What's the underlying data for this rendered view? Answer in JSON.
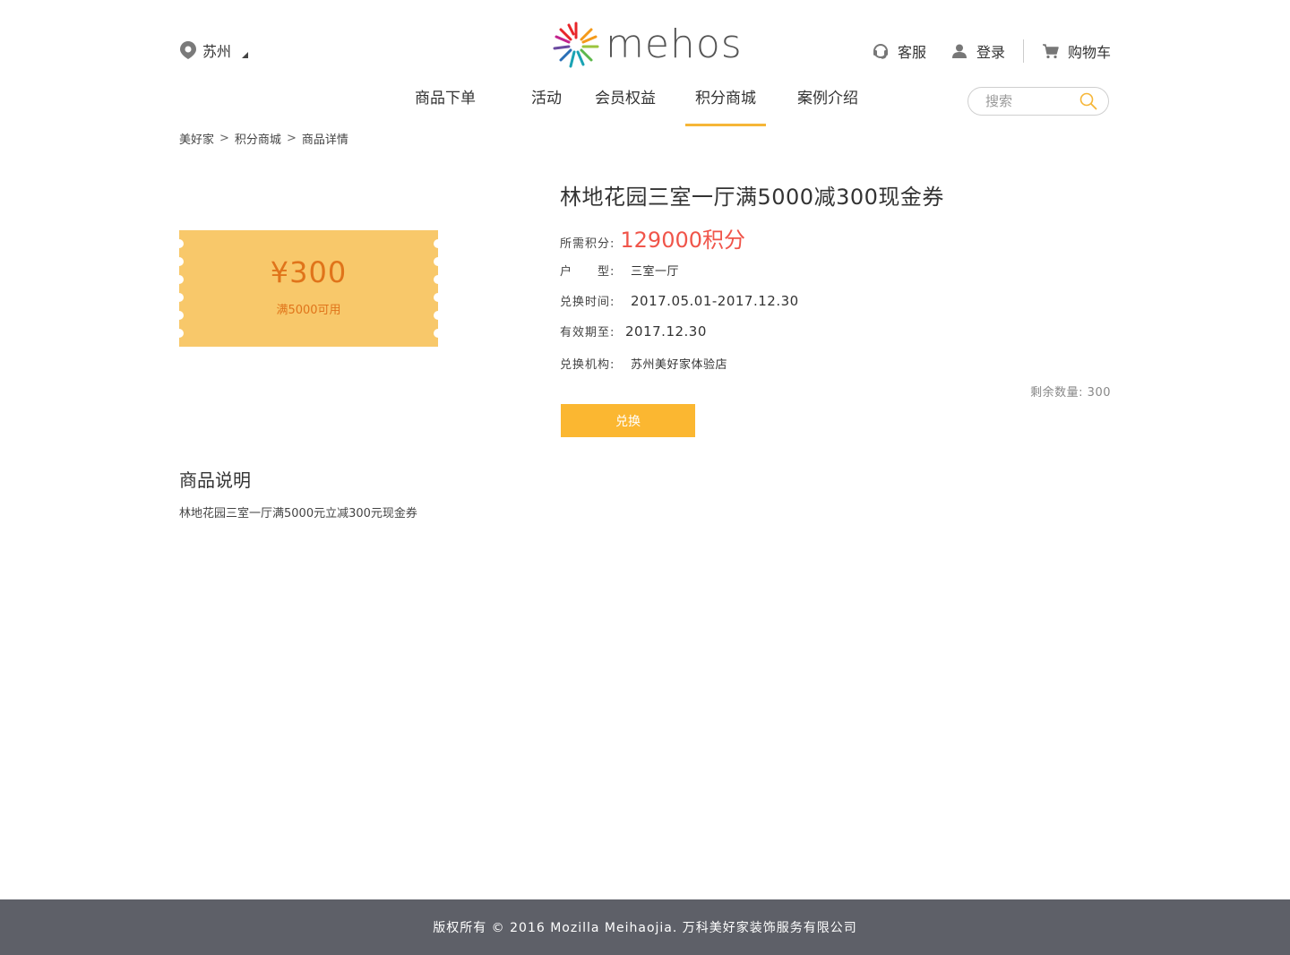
{
  "header": {
    "city": "苏州",
    "logo_text": "mehos",
    "service": "客服",
    "login": "登录",
    "cart": "购物车"
  },
  "nav": {
    "items": [
      "商品下单",
      "活动",
      "会员权益",
      "积分商城",
      "案例介绍"
    ],
    "active": "积分商城"
  },
  "search": {
    "placeholder": "搜索"
  },
  "breadcrumb": [
    "美好家",
    "积分商城",
    "商品详情"
  ],
  "coupon": {
    "amount": "¥300",
    "condition": "满5000可用"
  },
  "product": {
    "title": "林地花园三室一厅满5000减300现金券",
    "points_label": "所需积分:",
    "points_value": "129000积分",
    "type_label": "户　　型:",
    "type_value": "三室一厅",
    "time_label": "兑换时间:",
    "time_value": "2017.05.01-2017.12.30",
    "valid_label": "有效期至:",
    "valid_value": "2017.12.30",
    "org_label": "兑换机构:",
    "org_value": "苏州美好家体验店",
    "remain": "剩余数量: 300",
    "exchange_button": "兑换"
  },
  "description": {
    "heading": "商品说明",
    "text": "林地花园三室一厅满5000元立减300元现金券"
  },
  "footer": {
    "text": "版权所有 © 2016 Mozilla Meihaojia. 万科美好家装饰服务有限公司"
  },
  "colors": {
    "accent": "#f6b637",
    "price": "#f0554a",
    "coupon": "#f8c86a",
    "button": "#fbb731",
    "footer": "#5e6068"
  }
}
